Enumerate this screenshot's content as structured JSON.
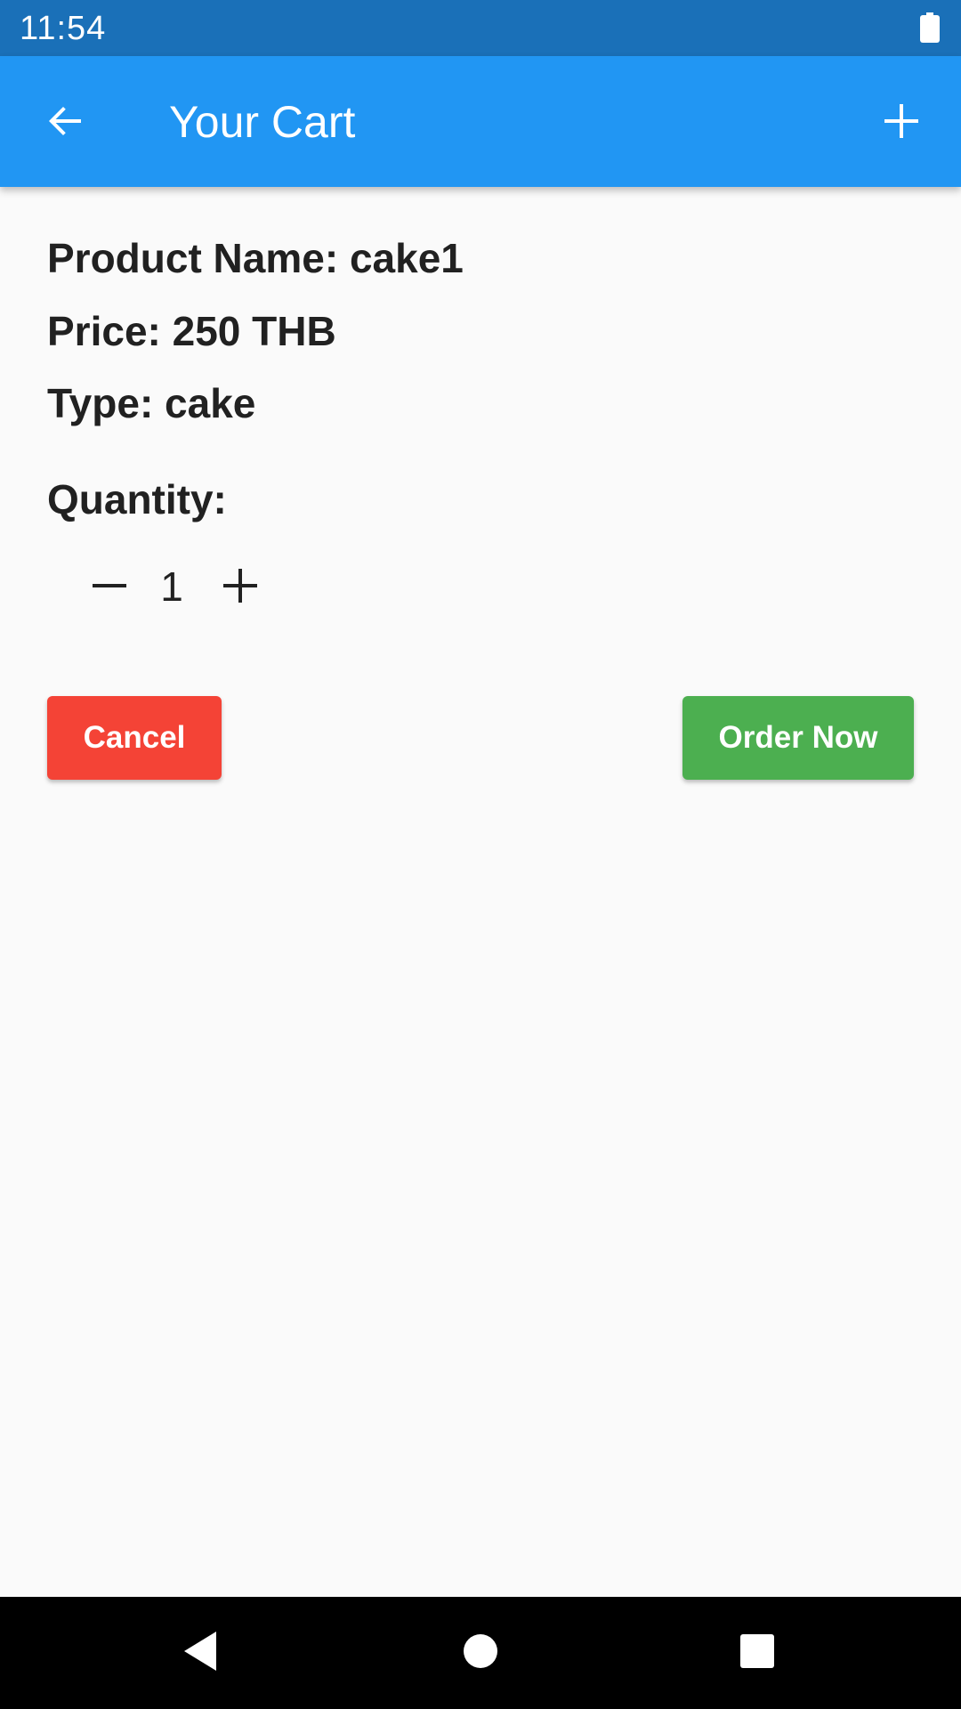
{
  "status_bar": {
    "time": "11:54",
    "battery_icon": "battery-full-icon"
  },
  "app_bar": {
    "title": "Your Cart",
    "back_icon": "arrow-back-icon",
    "add_icon": "plus-icon",
    "color": "#2196f3"
  },
  "product": {
    "name_line": "Product Name: cake1",
    "price_line": "Price: 250 THB",
    "type_line": "Type: cake"
  },
  "quantity": {
    "label": "Quantity:",
    "value": "1",
    "decrement_icon": "minus-icon",
    "increment_icon": "plus-icon"
  },
  "actions": {
    "cancel_label": "Cancel",
    "cancel_color": "#f44336",
    "order_label": "Order Now",
    "order_color": "#4caf50"
  },
  "nav_bar": {
    "back_icon": "nav-back-icon",
    "home_icon": "nav-home-icon",
    "recents_icon": "nav-recents-icon"
  }
}
